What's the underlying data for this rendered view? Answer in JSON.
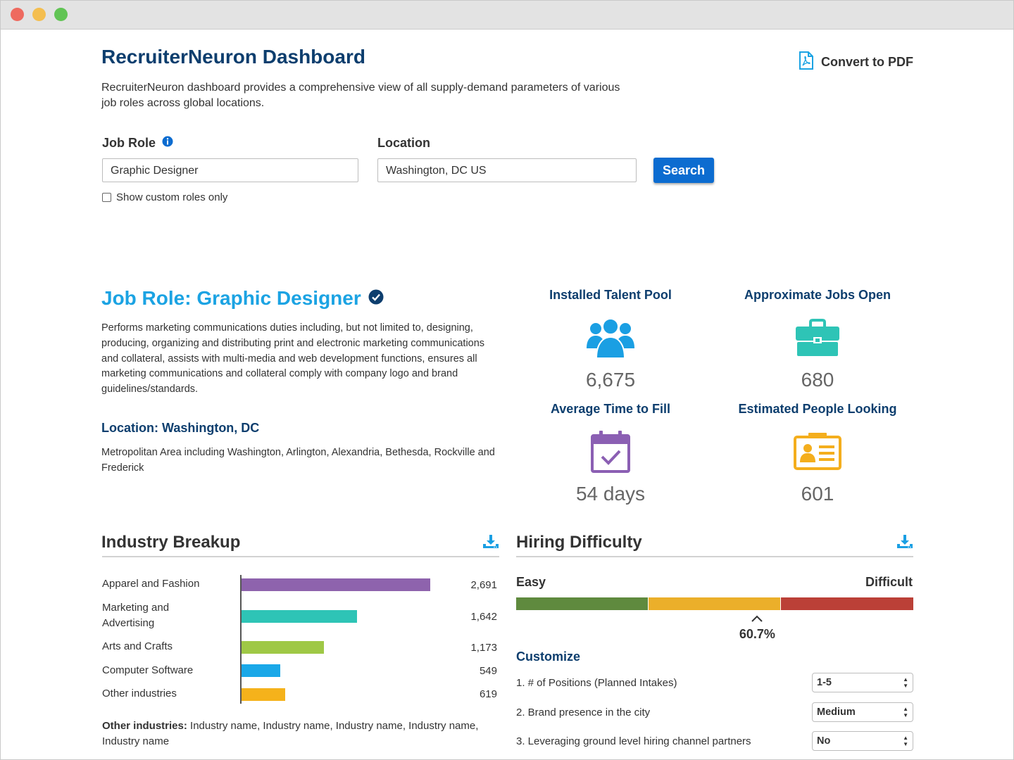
{
  "header": {
    "title": "RecruiterNeuron Dashboard",
    "description": "RecruiterNeuron dashboard provides a comprehensive view of all supply-demand parameters of various job roles across global locations.",
    "pdf_label": "Convert to PDF"
  },
  "search": {
    "job_role_label": "Job Role",
    "job_role_value": "Graphic Designer",
    "location_label": "Location",
    "location_value": "Washington, DC US",
    "button_label": "Search",
    "custom_roles_label": "Show custom roles only"
  },
  "role": {
    "title": "Job Role: Graphic Designer",
    "description": "Performs marketing communications duties including, but not limited to, designing, producing, organizing and distributing print and electronic marketing communications and collateral, assists with multi-media and web development functions, ensures all marketing communications and collateral comply with company logo and brand guidelines/standards.",
    "location_title": "Location: Washington, DC",
    "location_description": "Metropolitan Area including Washington, Arlington, Alexandria, Bethesda, Rockville and Frederick"
  },
  "stats": [
    {
      "title": "Installed Talent Pool",
      "value": "6,675",
      "icon": "people-group-icon",
      "color": "#1a9fe3"
    },
    {
      "title": "Approximate Jobs Open",
      "value": "680",
      "icon": "briefcase-icon",
      "color": "#2ec4b6"
    },
    {
      "title": "Average Time to Fill",
      "value": "54 days",
      "icon": "calendar-check-icon",
      "color": "#8b5fb3"
    },
    {
      "title": "Estimated People Looking",
      "value": "601",
      "icon": "id-card-icon",
      "color": "#f4ae1d"
    }
  ],
  "industry": {
    "title": "Industry Breakup",
    "other_label": "Other industries:",
    "other_text": " Industry name, Industry name, Industry name, Industry name, Industry name"
  },
  "chart_data": {
    "type": "bar",
    "orientation": "horizontal",
    "categories": [
      "Apparel and Fashion",
      "Marketing and Advertising",
      "Arts and Crafts",
      "Computer Software",
      "Other industries"
    ],
    "values": [
      2691,
      1642,
      1173,
      549,
      619
    ],
    "value_labels": [
      "2,691",
      "1,642",
      "1,173",
      "549",
      "619"
    ],
    "colors": [
      "#8e63ad",
      "#2ec4b6",
      "#9fc846",
      "#1aa8e8",
      "#f5b21b"
    ]
  },
  "hiring": {
    "title": "Hiring Difficulty",
    "easy_label": "Easy",
    "difficult_label": "Difficult",
    "value": 60.7,
    "value_label": "60.7%",
    "segment_colors": [
      "#5f8a3e",
      "#ebaf2a",
      "#bb4037"
    ],
    "customize_title": "Customize",
    "params": [
      {
        "label": "1. # of Positions (Planned Intakes)",
        "value": "1-5"
      },
      {
        "label": "2. Brand presence in the city",
        "value": "Medium"
      },
      {
        "label": "3. Leveraging ground level hiring channel partners",
        "value": "No"
      }
    ]
  }
}
